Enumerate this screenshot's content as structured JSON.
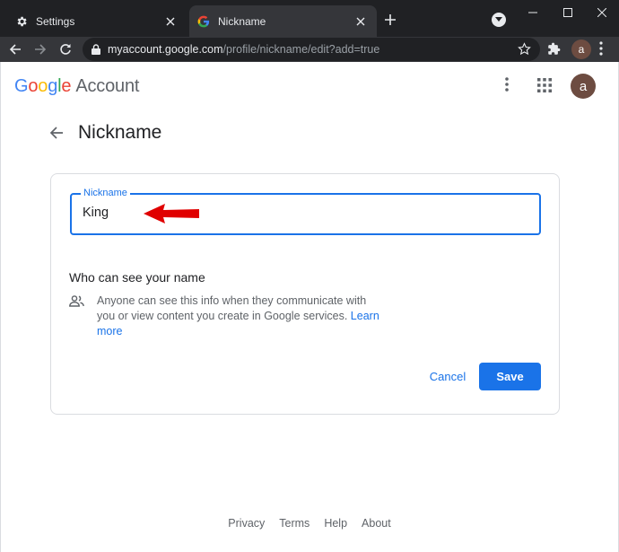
{
  "browser": {
    "tabs": [
      {
        "title": "Settings",
        "icon": "gear-icon",
        "active": false
      },
      {
        "title": "Nickname",
        "icon": "google-g-icon",
        "active": true
      }
    ],
    "url_host": "myaccount.google.com",
    "url_path": "/profile/nickname/edit?add=true",
    "profile_initial": "a"
  },
  "header": {
    "logo_letters": [
      "G",
      "o",
      "o",
      "g",
      "l",
      "e"
    ],
    "logo_suffix": "Account",
    "avatar_initial": "a"
  },
  "page": {
    "title": "Nickname"
  },
  "form": {
    "nickname_label": "Nickname",
    "nickname_value": "King",
    "visibility_title": "Who can see your name",
    "visibility_text": "Anyone can see this info when they communicate with you or view content you create in Google services.",
    "learn_more": "Learn more",
    "cancel_label": "Cancel",
    "save_label": "Save"
  },
  "footer": {
    "links": [
      "Privacy",
      "Terms",
      "Help",
      "About"
    ]
  },
  "colors": {
    "accent": "#1a73e8",
    "annotation_arrow": "#e00000"
  }
}
